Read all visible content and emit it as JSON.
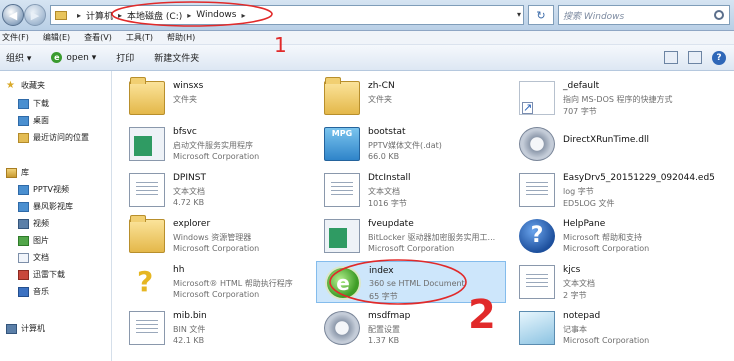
{
  "address": {
    "crumbs": [
      "计算机",
      "本地磁盘 (C:)",
      "Windows"
    ],
    "search_placeholder": "搜索 Windows"
  },
  "menu": [
    "文件(F)",
    "编辑(E)",
    "查看(V)",
    "工具(T)",
    "帮助(H)"
  ],
  "toolbar": {
    "organize": "组织 ▾",
    "open": "open ▾",
    "print": "打印",
    "new_folder": "新建文件夹"
  },
  "nav": {
    "favorites": "收藏夹",
    "downloads": "下载",
    "desktop": "桌面",
    "recent": "最近访问的位置",
    "libraries": "库",
    "pptv": "PPTV视频",
    "storm": "暴风影视库",
    "videos": "视频",
    "pictures": "图片",
    "documents": "文档",
    "xunlei": "迅雷下载",
    "music": "音乐",
    "computer": "计算机"
  },
  "files": [
    {
      "name": "winsxs",
      "l2": "文件夹",
      "l3": "",
      "icon": "folder-icon"
    },
    {
      "name": "bfsvc",
      "l2": "启动文件服务实用程序",
      "l3": "Microsoft Corporation",
      "icon": "exe-icon"
    },
    {
      "name": "DPINST",
      "l2": "文本文档",
      "l3": "4.72 KB",
      "icon": "text-file-icon"
    },
    {
      "name": "explorer",
      "l2": "Windows 资源管理器",
      "l3": "Microsoft Corporation",
      "icon": "folder-icon"
    },
    {
      "name": "hh",
      "l2": "Microsoft® HTML 帮助执行程序",
      "l3": "Microsoft Corporation",
      "icon": "help-exe-icon"
    },
    {
      "name": "mib.bin",
      "l2": "BIN 文件",
      "l3": "42.1 KB",
      "icon": "text-file-icon"
    },
    {
      "name": "zh-CN",
      "l2": "文件夹",
      "l3": "",
      "icon": "folder-icon"
    },
    {
      "name": "bootstat",
      "l2": "PPTV媒体文件(.dat)",
      "l3": "66.0 KB",
      "icon": "mpg-icon"
    },
    {
      "name": "DtcInstall",
      "l2": "文本文档",
      "l3": "1016 字节",
      "icon": "text-file-icon"
    },
    {
      "name": "fveupdate",
      "l2": "BitLocker 驱动器加密服务实用工...",
      "l3": "Microsoft Corporation",
      "icon": "exe-icon"
    },
    {
      "name": "index",
      "l2": "360 se HTML Document",
      "l3": "65 字节",
      "icon": "ie-icon"
    },
    {
      "name": "msdfmap",
      "l2": "配置设置",
      "l3": "1.37 KB",
      "icon": "settings-icon"
    },
    {
      "name": "_default",
      "l2": "指向 MS-DOS 程序的快捷方式",
      "l3": "707 字节",
      "icon": "shortcut-icon"
    },
    {
      "name": "DirectXRunTime.dll",
      "l2": "",
      "l3": "",
      "icon": "settings-icon"
    },
    {
      "name": "EasyDrv5_20151229_092044.ed5",
      "l2": "log 字节",
      "l3": "ED5LOG 文件",
      "icon": "text-file-icon"
    },
    {
      "name": "HelpPane",
      "l2": "Microsoft 帮助和支持",
      "l3": "Microsoft Corporation",
      "icon": "help-icon"
    },
    {
      "name": "kjcs",
      "l2": "文本文档",
      "l3": "2 字节",
      "icon": "text-file-icon"
    },
    {
      "name": "notepad",
      "l2": "记事本",
      "l3": "Microsoft Corporation",
      "icon": "notepad-icon"
    }
  ],
  "annotations": {
    "mark1": "1",
    "mark2": "2"
  }
}
